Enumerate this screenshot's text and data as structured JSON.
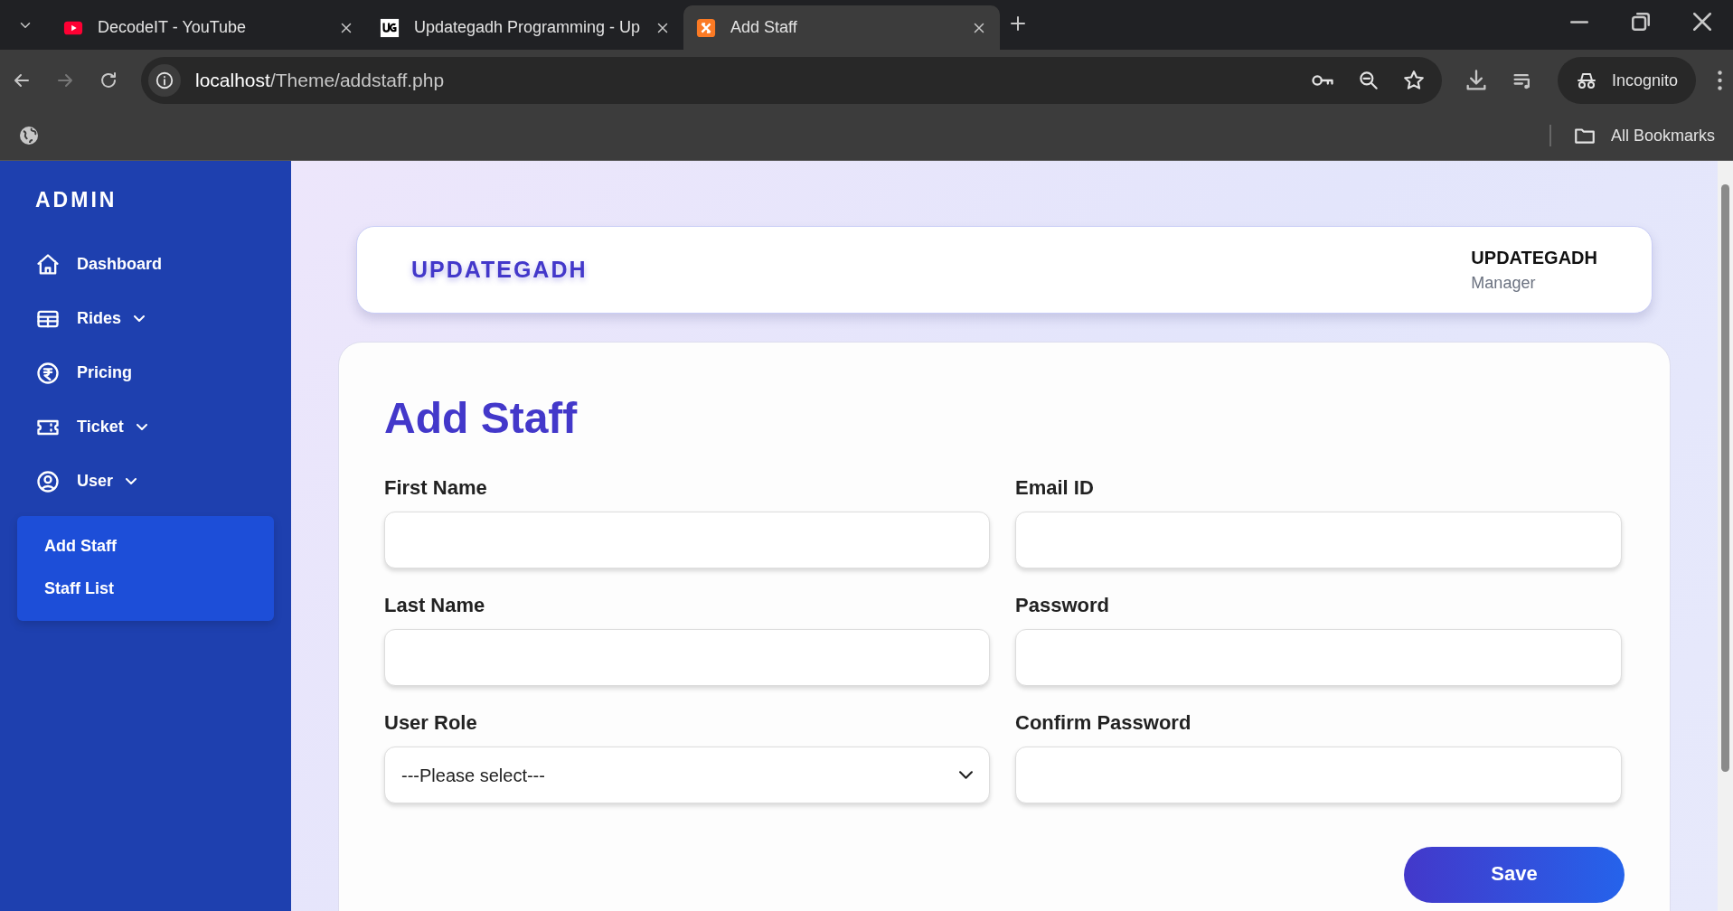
{
  "browser": {
    "tabs": [
      {
        "title": "DecodeIT - YouTube",
        "selected": false
      },
      {
        "title": "Updategadh Programming - Up",
        "selected": false
      },
      {
        "title": "Add Staff",
        "selected": true
      }
    ],
    "address": {
      "host": "localhost",
      "path": "/Theme/addstaff.php"
    },
    "profile": "Incognito",
    "bookmarks": "All Bookmarks"
  },
  "sidebar": {
    "title": "ADMIN",
    "items": [
      {
        "label": "Dashboard"
      },
      {
        "label": "Rides",
        "has_submenu": true
      },
      {
        "label": "Pricing"
      },
      {
        "label": "Ticket",
        "has_submenu": true
      },
      {
        "label": "User",
        "has_submenu": true,
        "expanded": true,
        "children": [
          {
            "label": "Add Staff"
          },
          {
            "label": "Staff List"
          }
        ]
      }
    ]
  },
  "header": {
    "brand": "UPDATEGADH",
    "user_name": "UPDATEGADH",
    "user_role": "Manager"
  },
  "form": {
    "title": "Add Staff",
    "fields": [
      {
        "label": "First Name",
        "kind": "text"
      },
      {
        "label": "Email ID",
        "kind": "text"
      },
      {
        "label": "Last Name",
        "kind": "text"
      },
      {
        "label": "Password",
        "kind": "password"
      },
      {
        "label": "User Role",
        "kind": "select",
        "value": "---Please select---"
      },
      {
        "label": "Confirm Password",
        "kind": "password"
      }
    ],
    "submit": "Save"
  }
}
